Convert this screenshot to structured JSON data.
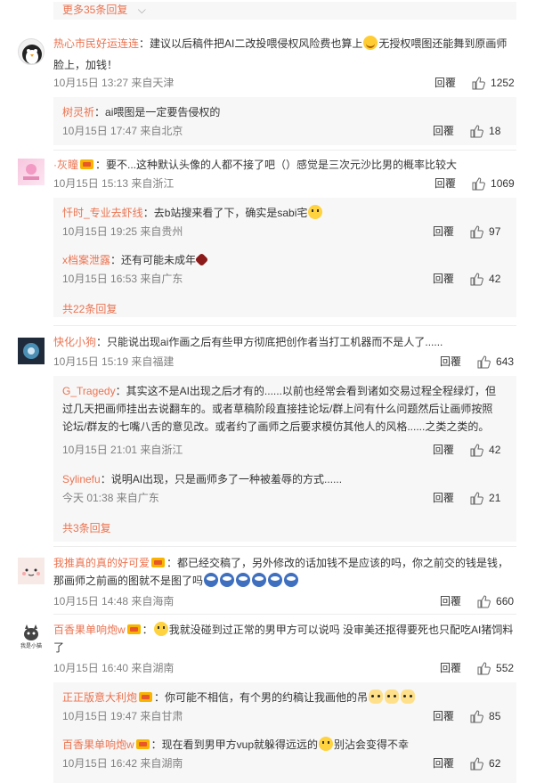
{
  "top_more": {
    "label": "更多35条回复"
  },
  "comments": [
    {
      "user": "热心市民好运连连",
      "text_a": "：建议以后稿件把AI二改投喂侵权风险费也算上",
      "text_b": "无授权喂图还能舞到原画师",
      "text_c": "脸上，加钱！",
      "date": "10月15日 13:27",
      "location": "来自天津",
      "reply_label": "回覆",
      "likes": "1252",
      "replies": [
        {
          "user": "树灵祈",
          "text": "：ai喂图是一定要告侵权的",
          "date": "10月15日 17:47",
          "location": "来自北京",
          "reply_label": "回覆",
          "likes": "18"
        }
      ]
    },
    {
      "user": "·灰瞳",
      "text": "：要不...这种默认头像的人都不接了吧（）感觉是三次元沙比男的概率比较大",
      "date": "10月15日 15:13",
      "location": "来自浙江",
      "reply_label": "回覆",
      "likes": "1069",
      "replies": [
        {
          "user": "忏时_专业去虾线",
          "text": "：去b站搜来看了下，确实是sabi宅",
          "date": "10月15日 19:25",
          "location": "来自贵州",
          "reply_label": "回覆",
          "likes": "97"
        },
        {
          "user": "x档案泄露",
          "text": "：还有可能未成年",
          "date": "10月15日 16:53",
          "location": "来自广东",
          "reply_label": "回覆",
          "likes": "42"
        }
      ],
      "more": "共22条回复"
    },
    {
      "user": "快化小狗",
      "text": "：只能说出现ai作画之后有些甲方彻底把创作者当打工机器而不是人了......",
      "date": "10月15日 15:19",
      "location": "来自福建",
      "reply_label": "回覆",
      "likes": "643",
      "replies": [
        {
          "user": "G_Tragedy",
          "text_1": "：其实这不是AI出现之后才有的......以前也经常会看到诸如交易过程全程绿灯，但",
          "text_2": "过几天把画师挂出去说翻车的。或者草稿阶段直接挂论坛/群上问有什么问题然后让画师按照",
          "text_3": "论坛/群友的七嘴八舌的意见改。或者约了画师之后要求模仿其他人的风格......之类之类的。",
          "date": "10月15日 21:01",
          "location": "来自浙江",
          "reply_label": "回覆",
          "likes": "42"
        },
        {
          "user": "Sylinefu",
          "text": "：说明AI出现，只是画师多了一种被羞辱的方式......",
          "date": "今天 01:38",
          "location": "来自广东",
          "reply_label": "回覆",
          "likes": "21"
        }
      ],
      "more": "共3条回复"
    },
    {
      "user": "我推真的真的好可爱",
      "text_1": "：都已经交稿了，另外修改的话加钱不是应该的吗，你之前交的钱是钱，",
      "text_2": "那画师之前画的图就不是图了吗",
      "date": "10月15日 14:48",
      "location": "来自海南",
      "reply_label": "回覆",
      "likes": "660"
    },
    {
      "user": "百香果单响炮w",
      "avatar_text": "我是小猫",
      "text_1": "我就没碰到过正常的男甲方可以说吗 没审美还抠得要死也只配吃AI猪饲料",
      "text_2": "了",
      "date": "10月15日 16:40",
      "location": "来自湖南",
      "reply_label": "回覆",
      "likes": "552",
      "replies": [
        {
          "user": "正正版意大利炮",
          "text": "：你可能不相信，有个男的约稿让我画他的吊",
          "date": "10月15日 19:47",
          "location": "来自甘肃",
          "reply_label": "回覆",
          "likes": "85"
        },
        {
          "user": "百香果单响炮w",
          "text_a": "：现在看到男甲方vup就躲得远远的",
          "text_b": "别沾会变得不幸",
          "date": "10月15日 16:42",
          "location": "来自湖南",
          "reply_label": "回覆",
          "likes": "62"
        }
      ]
    }
  ],
  "colors": {
    "username": "#eb7350",
    "meta": "#808080",
    "reply_bg": "#f7f7f7",
    "text": "#333333"
  }
}
